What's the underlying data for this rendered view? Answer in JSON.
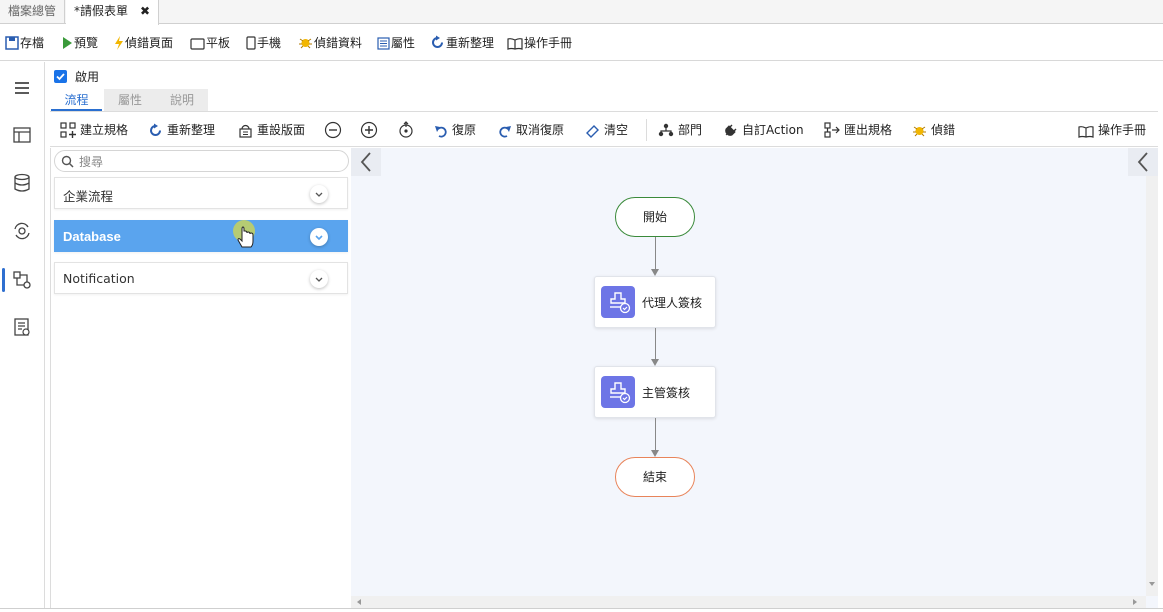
{
  "doc_tabs": [
    {
      "label": "檔案總管",
      "active": false
    },
    {
      "label": "*請假表單",
      "active": true,
      "close": "✖"
    }
  ],
  "toolbar": {
    "save": "存檔",
    "preview": "預覽",
    "debug_page": "偵錯頁面",
    "tablet": "平板",
    "mobile": "手機",
    "debug_data": "偵錯資料",
    "properties": "屬性",
    "refresh": "重新整理",
    "manual": "操作手冊"
  },
  "rail_icons": [
    "menu-icon",
    "table-icon",
    "database-icon",
    "settings-sync-icon",
    "flow-icon",
    "report-icon"
  ],
  "enable_label": "啟用",
  "enabled": true,
  "inner_tabs": [
    "流程",
    "屬性",
    "說明"
  ],
  "flow_toolbar": {
    "create_spec": "建立規格",
    "refresh": "重新整理",
    "reset_layout": "重設版面",
    "undo": "復原",
    "redo": "取消復原",
    "clear": "清空",
    "department": "部門",
    "custom_action": "自訂Action",
    "export_spec": "匯出規格",
    "debug": "偵錯",
    "manual": "操作手冊"
  },
  "search": {
    "placeholder": "搜尋"
  },
  "categories": [
    {
      "label": "企業流程",
      "selected": false
    },
    {
      "label": "Database",
      "selected": true
    },
    {
      "label": "Notification",
      "selected": false
    }
  ],
  "flow": {
    "start": "開始",
    "step1": "代理人簽核",
    "step2": "主管簽核",
    "end": "結束"
  },
  "colors": {
    "accent": "#2a6fd0",
    "selected_category": "#5aa4ee",
    "approval_badge": "#6d75e6",
    "start_border": "#3a8a3a",
    "end_border": "#e8845a",
    "canvas_bg": "#f3f6fc"
  }
}
